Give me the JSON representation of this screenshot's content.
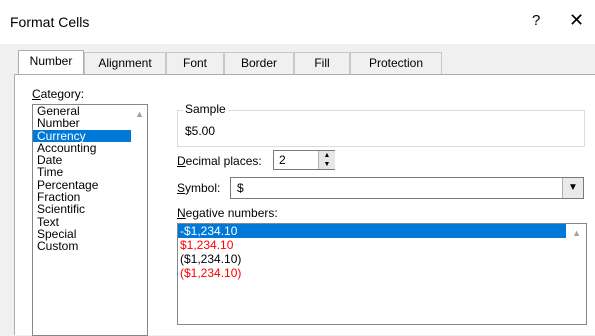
{
  "window": {
    "title": "Format Cells",
    "help": "?",
    "close": "✕"
  },
  "tabs": [
    {
      "label": "Number"
    },
    {
      "label": "Alignment"
    },
    {
      "label": "Font"
    },
    {
      "label": "Border"
    },
    {
      "label": "Fill"
    },
    {
      "label": "Protection"
    }
  ],
  "category": {
    "label_accel": "C",
    "label_rest": "ategory:",
    "items": [
      "General",
      "Number",
      "Currency",
      "Accounting",
      "Date",
      "Time",
      "Percentage",
      "Fraction",
      "Scientific",
      "Text",
      "Special",
      "Custom"
    ],
    "selected": "Currency"
  },
  "sample": {
    "title": "Sample",
    "value": "$5.00"
  },
  "decimal": {
    "label_accel": "D",
    "label_rest": "ecimal places:",
    "value": "2"
  },
  "symbol": {
    "label_accel": "S",
    "label_rest": "ymbol:",
    "value": "$"
  },
  "negative": {
    "label_accel": "N",
    "label_rest": "egative numbers:",
    "items": [
      "-$1,234.10",
      "$1,234.10",
      "($1,234.10)",
      "($1,234.10)"
    ],
    "selected": "-$1,234.10"
  }
}
